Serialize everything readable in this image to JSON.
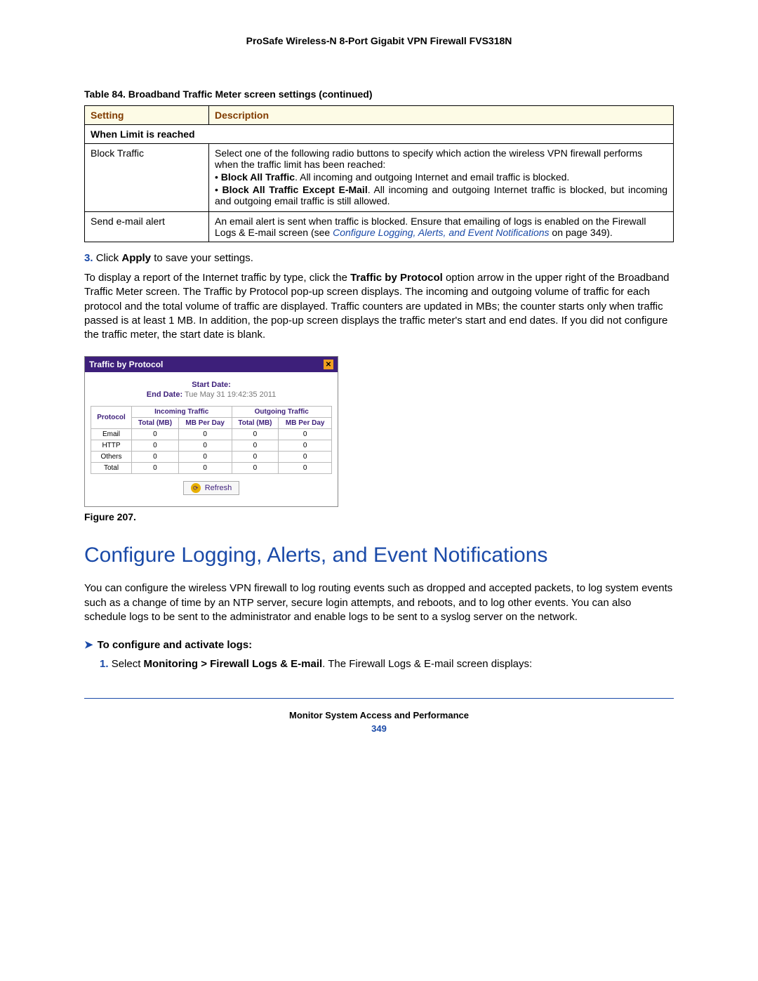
{
  "doc_title": "ProSafe Wireless-N 8-Port Gigabit VPN Firewall FVS318N",
  "table_caption": "Table 84.  Broadband Traffic Meter screen settings (continued)",
  "settings_table": {
    "headers": {
      "setting": "Setting",
      "description": "Description"
    },
    "section_label": "When Limit is reached",
    "row_block": {
      "setting": "Block Traffic",
      "desc_intro": "Select one of the following radio buttons to specify which action the wireless VPN firewall performs when the traffic limit has been reached:",
      "bullet1_bold": "Block All Traffic",
      "bullet1_rest": ". All incoming and outgoing Internet and email traffic is blocked.",
      "bullet2_bold": "Block All Traffic Except E-Mail",
      "bullet2_rest": ". All incoming and outgoing Internet traffic is blocked, but incoming and outgoing email traffic is still allowed."
    },
    "row_email": {
      "setting": "Send e-mail alert",
      "desc_pre": "An email alert is sent when traffic is blocked. Ensure that emailing of logs is enabled on the Firewall Logs & E-mail screen (see ",
      "link": "Configure Logging, Alerts, and Event Notifications",
      "desc_post": " on page 349)."
    }
  },
  "step3": {
    "num": "3.",
    "pre": "Click ",
    "bold": "Apply",
    "post": " to save your settings."
  },
  "body_para_parts": {
    "pre": "To display a report of the Internet traffic by type, click the ",
    "bold": "Traffic by Protocol",
    "post": " option arrow in the upper right of the Broadband Traffic Meter screen. The Traffic by Protocol pop-up screen displays. The incoming and outgoing volume of traffic for each protocol and the total volume of traffic are displayed. Traffic counters are updated in MBs; the counter starts only when traffic passed is at least 1 MB. In addition, the pop-up screen displays the traffic meter's start and end dates. If you did not configure the traffic meter, the start date is blank."
  },
  "popup": {
    "title": "Traffic by Protocol",
    "start_label": "Start Date:",
    "start_value": "",
    "end_label": "End Date:",
    "end_value": "Tue May 31 19:42:35 2011",
    "headers": {
      "protocol": "Protocol",
      "incoming": "Incoming Traffic",
      "outgoing": "Outgoing Traffic",
      "total_mb": "Total (MB)",
      "mb_per_day": "MB Per Day"
    },
    "rows": [
      {
        "protocol": "Email",
        "in_total": "0",
        "in_perday": "0",
        "out_total": "0",
        "out_perday": "0"
      },
      {
        "protocol": "HTTP",
        "in_total": "0",
        "in_perday": "0",
        "out_total": "0",
        "out_perday": "0"
      },
      {
        "protocol": "Others",
        "in_total": "0",
        "in_perday": "0",
        "out_total": "0",
        "out_perday": "0"
      },
      {
        "protocol": "Total",
        "in_total": "0",
        "in_perday": "0",
        "out_total": "0",
        "out_perday": "0"
      }
    ],
    "refresh_label": "Refresh"
  },
  "figure_caption": "Figure 207.",
  "section_heading": "Configure Logging, Alerts, and Event Notifications",
  "section_para": "You can configure the wireless VPN firewall to log routing events such as dropped and accepted packets, to log system events such as a change of time by an NTP server, secure login attempts, and reboots, and to log other events. You can also schedule logs to be sent to the administrator and enable logs to be sent to a syslog server on the network.",
  "sub_heading": "To configure and activate logs:",
  "step1": {
    "num": "1.",
    "pre": "Select ",
    "bold": "Monitoring > Firewall Logs & E-mail",
    "post": ". The Firewall Logs & E-mail screen displays:"
  },
  "footer_title": "Monitor System Access and Performance",
  "footer_page": "349",
  "chart_data": {
    "type": "table",
    "title": "Traffic by Protocol",
    "columns": [
      "Protocol",
      "Incoming Total (MB)",
      "Incoming MB Per Day",
      "Outgoing Total (MB)",
      "Outgoing MB Per Day"
    ],
    "rows": [
      [
        "Email",
        0,
        0,
        0,
        0
      ],
      [
        "HTTP",
        0,
        0,
        0,
        0
      ],
      [
        "Others",
        0,
        0,
        0,
        0
      ],
      [
        "Total",
        0,
        0,
        0,
        0
      ]
    ],
    "start_date": "",
    "end_date": "Tue May 31 19:42:35 2011"
  }
}
